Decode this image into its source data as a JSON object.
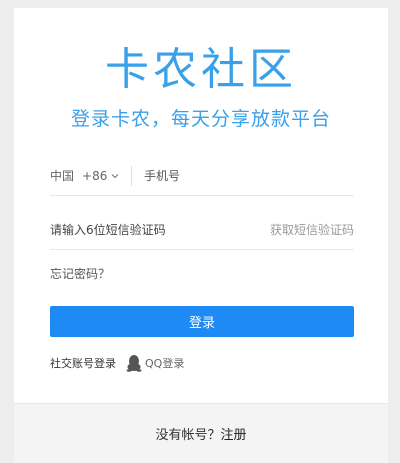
{
  "brand": {
    "logo_text": "卡农社区",
    "slogan": "登录卡农，每天分享放款平台",
    "accent_color": "#3aa0ea"
  },
  "phone": {
    "country": "中国",
    "code": "+86",
    "placeholder": "手机号"
  },
  "sms": {
    "placeholder": "请输入6位短信验证码",
    "get_code_label": "获取短信验证码"
  },
  "forgot_label": "忘记密码？",
  "login_label": "登录",
  "login_color": "#1e8bf5",
  "social": {
    "label": "社交账号登录",
    "qq_label": "QQ登录",
    "qq_icon": "qq-penguin-icon"
  },
  "footer": {
    "prompt": "没有帐号？",
    "register_label": "注册"
  }
}
